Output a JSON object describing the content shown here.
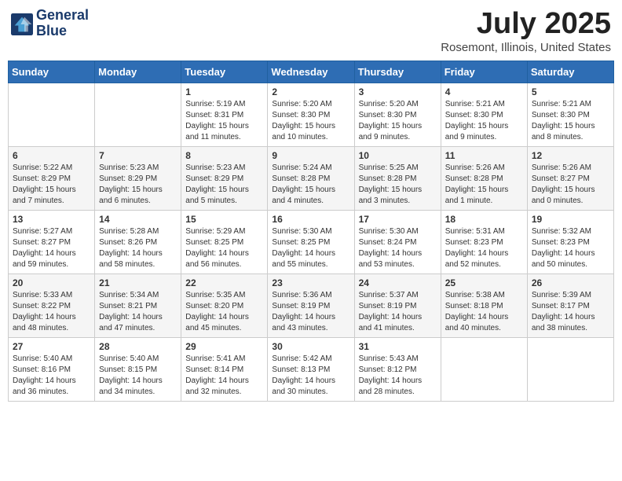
{
  "header": {
    "logo_line1": "General",
    "logo_line2": "Blue",
    "month_title": "July 2025",
    "location": "Rosemont, Illinois, United States"
  },
  "weekdays": [
    "Sunday",
    "Monday",
    "Tuesday",
    "Wednesday",
    "Thursday",
    "Friday",
    "Saturday"
  ],
  "weeks": [
    [
      {
        "day": "",
        "info": ""
      },
      {
        "day": "",
        "info": ""
      },
      {
        "day": "1",
        "info": "Sunrise: 5:19 AM\nSunset: 8:31 PM\nDaylight: 15 hours and 11 minutes."
      },
      {
        "day": "2",
        "info": "Sunrise: 5:20 AM\nSunset: 8:30 PM\nDaylight: 15 hours and 10 minutes."
      },
      {
        "day": "3",
        "info": "Sunrise: 5:20 AM\nSunset: 8:30 PM\nDaylight: 15 hours and 9 minutes."
      },
      {
        "day": "4",
        "info": "Sunrise: 5:21 AM\nSunset: 8:30 PM\nDaylight: 15 hours and 9 minutes."
      },
      {
        "day": "5",
        "info": "Sunrise: 5:21 AM\nSunset: 8:30 PM\nDaylight: 15 hours and 8 minutes."
      }
    ],
    [
      {
        "day": "6",
        "info": "Sunrise: 5:22 AM\nSunset: 8:29 PM\nDaylight: 15 hours and 7 minutes."
      },
      {
        "day": "7",
        "info": "Sunrise: 5:23 AM\nSunset: 8:29 PM\nDaylight: 15 hours and 6 minutes."
      },
      {
        "day": "8",
        "info": "Sunrise: 5:23 AM\nSunset: 8:29 PM\nDaylight: 15 hours and 5 minutes."
      },
      {
        "day": "9",
        "info": "Sunrise: 5:24 AM\nSunset: 8:28 PM\nDaylight: 15 hours and 4 minutes."
      },
      {
        "day": "10",
        "info": "Sunrise: 5:25 AM\nSunset: 8:28 PM\nDaylight: 15 hours and 3 minutes."
      },
      {
        "day": "11",
        "info": "Sunrise: 5:26 AM\nSunset: 8:28 PM\nDaylight: 15 hours and 1 minute."
      },
      {
        "day": "12",
        "info": "Sunrise: 5:26 AM\nSunset: 8:27 PM\nDaylight: 15 hours and 0 minutes."
      }
    ],
    [
      {
        "day": "13",
        "info": "Sunrise: 5:27 AM\nSunset: 8:27 PM\nDaylight: 14 hours and 59 minutes."
      },
      {
        "day": "14",
        "info": "Sunrise: 5:28 AM\nSunset: 8:26 PM\nDaylight: 14 hours and 58 minutes."
      },
      {
        "day": "15",
        "info": "Sunrise: 5:29 AM\nSunset: 8:25 PM\nDaylight: 14 hours and 56 minutes."
      },
      {
        "day": "16",
        "info": "Sunrise: 5:30 AM\nSunset: 8:25 PM\nDaylight: 14 hours and 55 minutes."
      },
      {
        "day": "17",
        "info": "Sunrise: 5:30 AM\nSunset: 8:24 PM\nDaylight: 14 hours and 53 minutes."
      },
      {
        "day": "18",
        "info": "Sunrise: 5:31 AM\nSunset: 8:23 PM\nDaylight: 14 hours and 52 minutes."
      },
      {
        "day": "19",
        "info": "Sunrise: 5:32 AM\nSunset: 8:23 PM\nDaylight: 14 hours and 50 minutes."
      }
    ],
    [
      {
        "day": "20",
        "info": "Sunrise: 5:33 AM\nSunset: 8:22 PM\nDaylight: 14 hours and 48 minutes."
      },
      {
        "day": "21",
        "info": "Sunrise: 5:34 AM\nSunset: 8:21 PM\nDaylight: 14 hours and 47 minutes."
      },
      {
        "day": "22",
        "info": "Sunrise: 5:35 AM\nSunset: 8:20 PM\nDaylight: 14 hours and 45 minutes."
      },
      {
        "day": "23",
        "info": "Sunrise: 5:36 AM\nSunset: 8:19 PM\nDaylight: 14 hours and 43 minutes."
      },
      {
        "day": "24",
        "info": "Sunrise: 5:37 AM\nSunset: 8:19 PM\nDaylight: 14 hours and 41 minutes."
      },
      {
        "day": "25",
        "info": "Sunrise: 5:38 AM\nSunset: 8:18 PM\nDaylight: 14 hours and 40 minutes."
      },
      {
        "day": "26",
        "info": "Sunrise: 5:39 AM\nSunset: 8:17 PM\nDaylight: 14 hours and 38 minutes."
      }
    ],
    [
      {
        "day": "27",
        "info": "Sunrise: 5:40 AM\nSunset: 8:16 PM\nDaylight: 14 hours and 36 minutes."
      },
      {
        "day": "28",
        "info": "Sunrise: 5:40 AM\nSunset: 8:15 PM\nDaylight: 14 hours and 34 minutes."
      },
      {
        "day": "29",
        "info": "Sunrise: 5:41 AM\nSunset: 8:14 PM\nDaylight: 14 hours and 32 minutes."
      },
      {
        "day": "30",
        "info": "Sunrise: 5:42 AM\nSunset: 8:13 PM\nDaylight: 14 hours and 30 minutes."
      },
      {
        "day": "31",
        "info": "Sunrise: 5:43 AM\nSunset: 8:12 PM\nDaylight: 14 hours and 28 minutes."
      },
      {
        "day": "",
        "info": ""
      },
      {
        "day": "",
        "info": ""
      }
    ]
  ]
}
